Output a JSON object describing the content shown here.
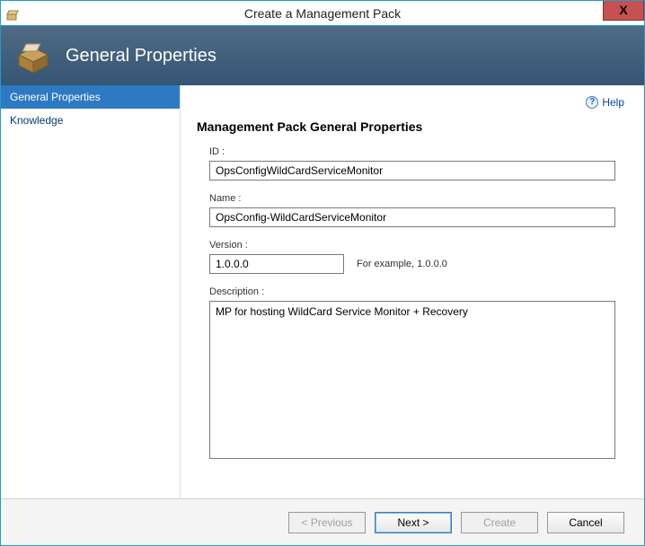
{
  "window": {
    "title": "Create a Management Pack",
    "close_glyph": "X"
  },
  "banner": {
    "title": "General Properties"
  },
  "sidebar": {
    "items": [
      {
        "label": "General Properties",
        "active": true
      },
      {
        "label": "Knowledge",
        "active": false
      }
    ]
  },
  "help": {
    "label": "Help",
    "glyph": "?"
  },
  "main": {
    "section_title": "Management Pack General Properties",
    "id_label": "ID :",
    "id_value": "OpsConfigWildCardServiceMonitor",
    "name_label": "Name :",
    "name_value": "OpsConfig-WildCardServiceMonitor",
    "version_label": "Version :",
    "version_value": "1.0.0.0",
    "version_hint": "For example, 1.0.0.0",
    "description_label": "Description :",
    "description_value": "MP for hosting WildCard Service Monitor + Recovery"
  },
  "footer": {
    "previous": "< Previous",
    "next": "Next >",
    "create": "Create",
    "cancel": "Cancel"
  }
}
